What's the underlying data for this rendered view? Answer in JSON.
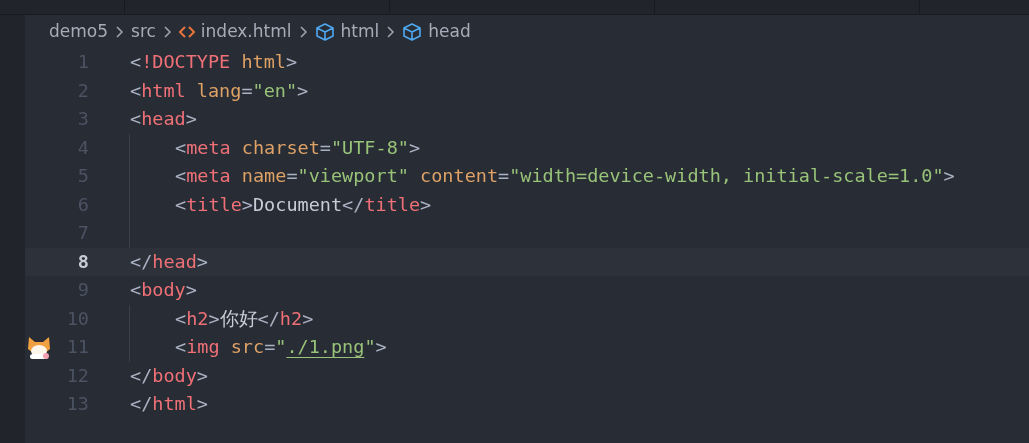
{
  "breadcrumb": [
    {
      "kind": "folder",
      "label": "demo5"
    },
    {
      "kind": "folder",
      "label": "src"
    },
    {
      "kind": "file",
      "label": "index.html"
    },
    {
      "kind": "symbol",
      "label": "html"
    },
    {
      "kind": "symbol",
      "label": "head"
    }
  ],
  "lines": [
    {
      "number": "1",
      "selected": false,
      "indented": false,
      "gutter_icon": false,
      "tokens": [
        {
          "kind": "punct",
          "text": "<"
        },
        {
          "kind": "tag",
          "text": "!DOCTYPE"
        },
        {
          "kind": "attr",
          "text": " html"
        },
        {
          "kind": "punct",
          "text": ">"
        }
      ]
    },
    {
      "number": "2",
      "selected": false,
      "indented": false,
      "gutter_icon": false,
      "tokens": [
        {
          "kind": "punct",
          "text": "<"
        },
        {
          "kind": "tag",
          "text": "html"
        },
        {
          "kind": "attr",
          "text": " lang"
        },
        {
          "kind": "punct",
          "text": "="
        },
        {
          "kind": "string",
          "text": "\"en\""
        },
        {
          "kind": "punct",
          "text": ">"
        }
      ]
    },
    {
      "number": "3",
      "selected": false,
      "indented": false,
      "gutter_icon": false,
      "tokens": [
        {
          "kind": "punct",
          "text": "<"
        },
        {
          "kind": "tag",
          "text": "head"
        },
        {
          "kind": "punct",
          "text": ">"
        }
      ]
    },
    {
      "number": "4",
      "selected": false,
      "indented": true,
      "gutter_icon": false,
      "tokens": [
        {
          "kind": "punct",
          "text": "<"
        },
        {
          "kind": "tag",
          "text": "meta"
        },
        {
          "kind": "attr",
          "text": " charset"
        },
        {
          "kind": "punct",
          "text": "="
        },
        {
          "kind": "string",
          "text": "\"UTF-8\""
        },
        {
          "kind": "punct",
          "text": ">"
        }
      ]
    },
    {
      "number": "5",
      "selected": false,
      "indented": true,
      "gutter_icon": false,
      "tokens": [
        {
          "kind": "punct",
          "text": "<"
        },
        {
          "kind": "tag",
          "text": "meta"
        },
        {
          "kind": "attr",
          "text": " name"
        },
        {
          "kind": "punct",
          "text": "="
        },
        {
          "kind": "string",
          "text": "\"viewport\""
        },
        {
          "kind": "attr",
          "text": " content"
        },
        {
          "kind": "punct",
          "text": "="
        },
        {
          "kind": "string",
          "text": "\"width=device-width, initial-scale=1.0\""
        },
        {
          "kind": "punct",
          "text": ">"
        }
      ]
    },
    {
      "number": "6",
      "selected": false,
      "indented": true,
      "gutter_icon": false,
      "tokens": [
        {
          "kind": "punct",
          "text": "<"
        },
        {
          "kind": "tag",
          "text": "title"
        },
        {
          "kind": "punct",
          "text": ">"
        },
        {
          "kind": "text",
          "text": "Document"
        },
        {
          "kind": "punct",
          "text": "</"
        },
        {
          "kind": "tag",
          "text": "title"
        },
        {
          "kind": "punct",
          "text": ">"
        }
      ]
    },
    {
      "number": "7",
      "selected": false,
      "indented": true,
      "gutter_icon": false
    },
    {
      "number": "8",
      "selected": true,
      "indented": false,
      "gutter_icon": false,
      "tokens": [
        {
          "kind": "punct",
          "text": "</"
        },
        {
          "kind": "tag",
          "text": "head"
        },
        {
          "kind": "punct",
          "text": ">"
        }
      ]
    },
    {
      "number": "9",
      "selected": false,
      "indented": false,
      "gutter_icon": false,
      "tokens": [
        {
          "kind": "punct",
          "text": "<"
        },
        {
          "kind": "tag",
          "text": "body"
        },
        {
          "kind": "punct",
          "text": ">"
        }
      ]
    },
    {
      "number": "10",
      "selected": false,
      "indented": true,
      "gutter_icon": false,
      "tokens": [
        {
          "kind": "punct",
          "text": "<"
        },
        {
          "kind": "tag",
          "text": "h2"
        },
        {
          "kind": "punct",
          "text": ">"
        },
        {
          "kind": "text",
          "text": "你好"
        },
        {
          "kind": "punct",
          "text": "</"
        },
        {
          "kind": "tag",
          "text": "h2"
        },
        {
          "kind": "punct",
          "text": ">"
        }
      ]
    },
    {
      "number": "11",
      "selected": false,
      "indented": true,
      "gutter_icon": true,
      "tokens": [
        {
          "kind": "punct",
          "text": "<"
        },
        {
          "kind": "tag",
          "text": "img"
        },
        {
          "kind": "attr",
          "text": " src"
        },
        {
          "kind": "punct",
          "text": "="
        },
        {
          "kind": "string",
          "text": "\""
        },
        {
          "kind": "link",
          "text": "./1.png"
        },
        {
          "kind": "string",
          "text": "\""
        },
        {
          "kind": "punct",
          "text": ">"
        }
      ]
    },
    {
      "number": "12",
      "selected": false,
      "indented": false,
      "gutter_icon": false,
      "tokens": [
        {
          "kind": "punct",
          "text": "</"
        },
        {
          "kind": "tag",
          "text": "body"
        },
        {
          "kind": "punct",
          "text": ">"
        }
      ]
    },
    {
      "number": "13",
      "selected": false,
      "indented": false,
      "gutter_icon": false,
      "tokens": [
        {
          "kind": "punct",
          "text": "</"
        },
        {
          "kind": "tag",
          "text": "html"
        },
        {
          "kind": "punct",
          "text": ">"
        }
      ]
    }
  ]
}
